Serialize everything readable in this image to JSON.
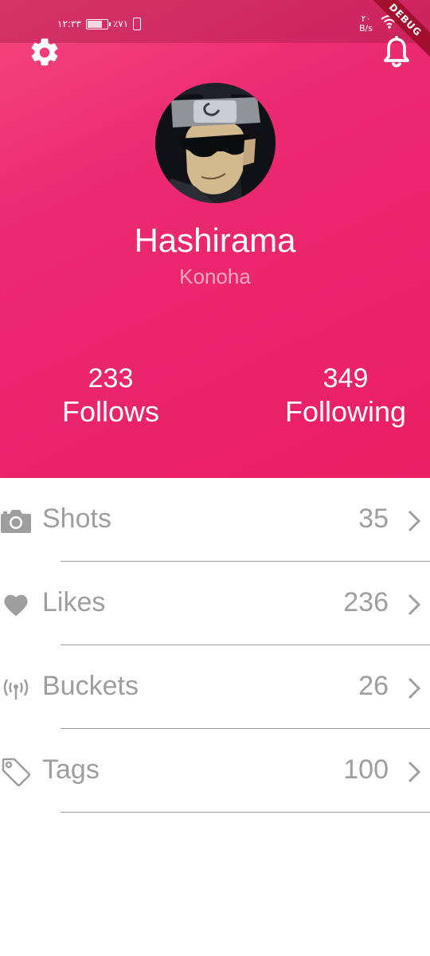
{
  "status_bar": {
    "time": "١٢:٣٣",
    "battery": "٪٧١",
    "net_speed": "٢٠",
    "net_unit": "B/s",
    "debug_label": "DEBUG"
  },
  "profile": {
    "name": "Hashirama",
    "location": "Konoha",
    "avatar_alt": "avatar"
  },
  "stats": {
    "follows": {
      "count": "233",
      "label": "Follows"
    },
    "following": {
      "count": "349",
      "label": "Following"
    }
  },
  "menu": {
    "items": [
      {
        "label": "Shots",
        "count": "35",
        "icon": "camera-icon"
      },
      {
        "label": "Likes",
        "count": "236",
        "icon": "heart-icon"
      },
      {
        "label": "Buckets",
        "count": "26",
        "icon": "antenna-icon"
      },
      {
        "label": "Tags",
        "count": "100",
        "icon": "tag-icon"
      }
    ]
  },
  "colors": {
    "accent": "#e91e63",
    "text_muted": "#9e9e9e",
    "location_text": "#f7a7c3"
  }
}
